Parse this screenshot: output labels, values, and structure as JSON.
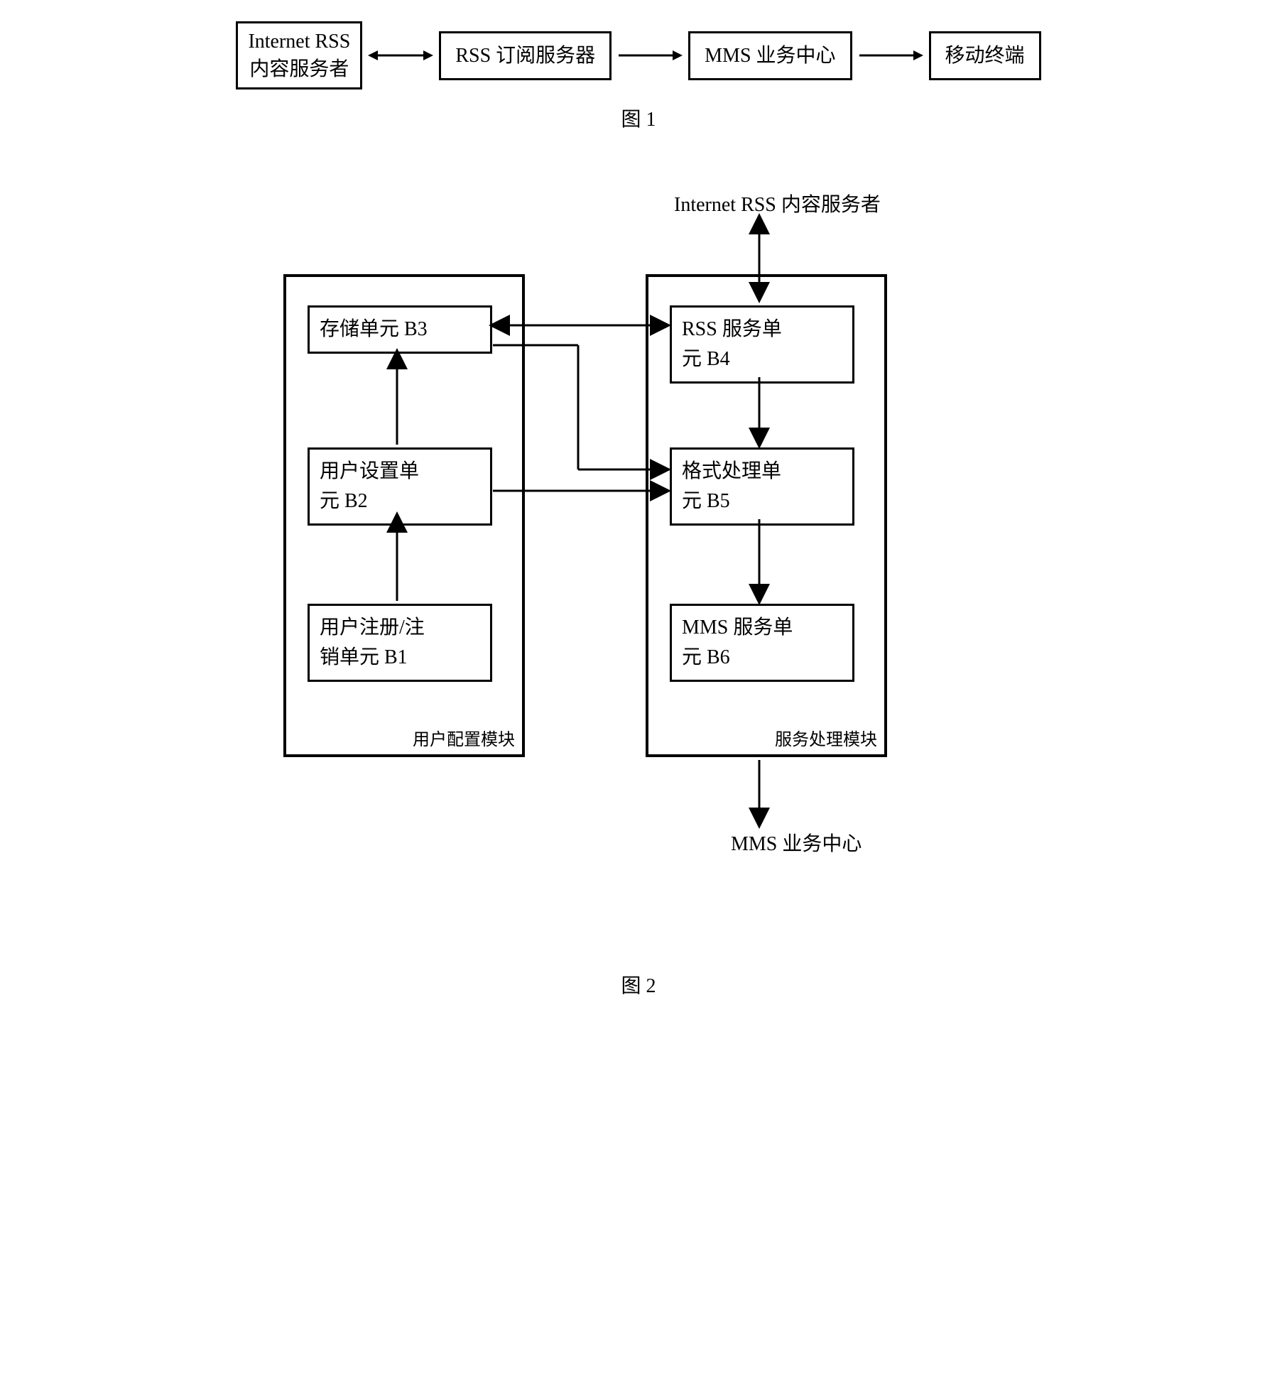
{
  "figure1": {
    "boxes": {
      "b1": "Internet RSS\n内容服务者",
      "b2": "RSS 订阅服务器",
      "b3": "MMS 业务中心",
      "b4": "移动终端"
    },
    "caption": "图 1"
  },
  "figure2": {
    "external": {
      "top": "Internet RSS 内容服务者",
      "bottom": "MMS 业务中心"
    },
    "leftModule": {
      "label": "用户配置模块",
      "b3": "存储单元 B3",
      "b2": "用户设置单\n元 B2",
      "b1": "用户注册/注\n销单元 B1"
    },
    "rightModule": {
      "label": "服务处理模块",
      "b4": "RSS  服务单\n元 B4",
      "b5": "格式处理单\n元 B5",
      "b6": "MMS 服务单\n元 B6"
    },
    "caption": "图 2"
  }
}
